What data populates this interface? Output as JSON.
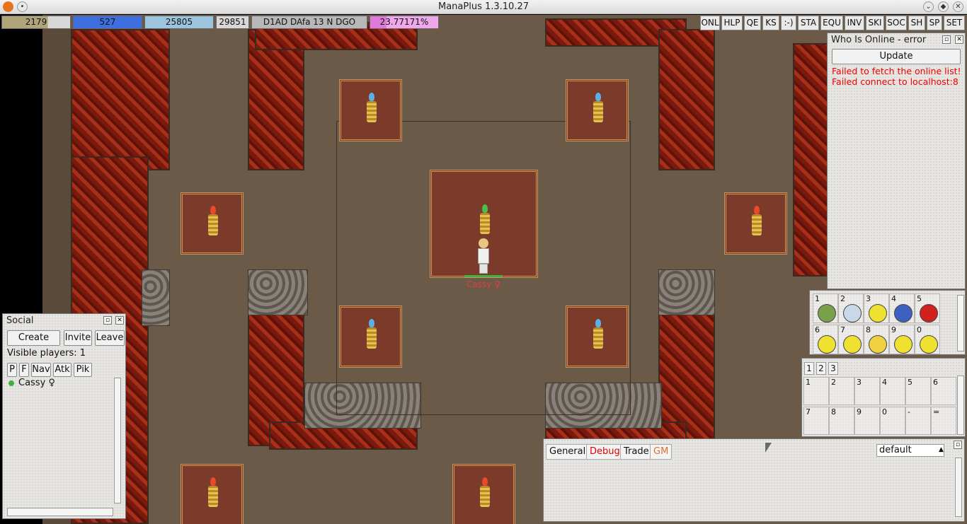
{
  "window": {
    "title": "ManaPlus 1.3.10.27"
  },
  "status": {
    "hp": "2179",
    "mp": "527",
    "xp": "25805",
    "money": "29851",
    "mode": "D1AD DAfa 13 N DGO",
    "job": "23.77171%"
  },
  "colors": {
    "hp": "#b0a47a",
    "mp": "#3d6fe0",
    "xp": "#9cc4dc",
    "job": "#e07ad8",
    "error": "#e00000",
    "gm": "#e07030"
  },
  "topbar": {
    "buttons": [
      "ONL",
      "HLP",
      "QE",
      "KS",
      ":-)",
      "STA",
      "EQU",
      "INV",
      "SKI",
      "SOC",
      "SH",
      "SP",
      "SET"
    ]
  },
  "online": {
    "title": "Who Is Online - error",
    "update_label": "Update",
    "errors": [
      "Failed to fetch the online list!",
      "Failed connect to localhost:8"
    ]
  },
  "social": {
    "title": "Social",
    "create": "Create",
    "invite": "Invite",
    "leave": "Leave",
    "visible": "Visible players: 1",
    "tabs": [
      "P",
      "F",
      "Nav",
      "Atk",
      "Pik"
    ],
    "player": "Cassy ♀"
  },
  "player": {
    "name": "Cassy ♀"
  },
  "emotes": {
    "slots": [
      {
        "num": "1",
        "icon": "sick-face-icon"
      },
      {
        "num": "2",
        "icon": "ghost-face-icon"
      },
      {
        "num": "3",
        "icon": "wink-face-icon"
      },
      {
        "num": "4",
        "icon": "blue-face-icon"
      },
      {
        "num": "5",
        "icon": "devil-face-icon"
      },
      {
        "num": "6",
        "icon": "sleepy-face-icon"
      },
      {
        "num": "7",
        "icon": "angel-face-icon"
      },
      {
        "num": "8",
        "icon": "worried-face-icon"
      },
      {
        "num": "9",
        "icon": "tongue-face-icon"
      },
      {
        "num": "0",
        "icon": "grin-face-icon"
      }
    ]
  },
  "shortcuts": {
    "tabs": [
      "1",
      "2",
      "3"
    ],
    "keys": [
      "1",
      "2",
      "3",
      "4",
      "5",
      "6",
      "7",
      "8",
      "9",
      "0",
      "-",
      "="
    ]
  },
  "chat": {
    "tabs": [
      "General",
      "Debug",
      "Trade",
      "GM"
    ],
    "channel": "default"
  }
}
